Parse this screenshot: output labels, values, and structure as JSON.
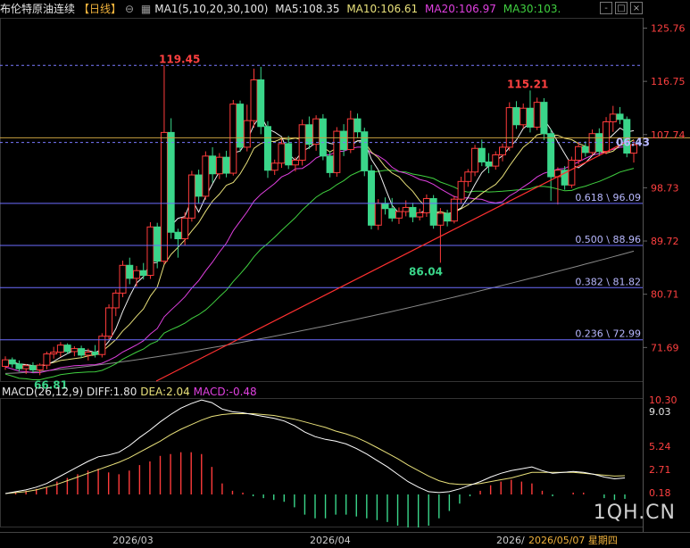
{
  "header": {
    "title": "布伦特原油连续",
    "period": "【日线】",
    "ctrl_icon": "circle-minus-icon",
    "ma_icon": "square-grid-icon",
    "ma1": "MA1(5,10,20,30,100)",
    "ma5": "MA5:108.35",
    "ma10": "MA10:106.61",
    "ma20": "MA20:106.97",
    "ma30": "MA30:103."
  },
  "window_buttons": [
    "-",
    "□",
    "×"
  ],
  "macd_header": {
    "title": "MACD(26,12,9) DIFF:1.80",
    "dea": "DEA:2.04",
    "macd": "MACD:-0.48"
  },
  "watermark": "1QH.CN",
  "colors": {
    "up": "#ff3b3b",
    "down": "#3ad68a",
    "ma5": "#f0f0f0",
    "ma10": "#e8e07a",
    "ma20": "#e040e0",
    "ma30": "#40d040",
    "ma100": "#8a8a8a",
    "trendline": "#ff3030",
    "fib": "#6c6cff"
  },
  "chart_data": [
    {
      "type": "candlestick",
      "ylim": [
        66.0,
        127.5
      ],
      "y_ticks": [
        125.76,
        116.75,
        107.74,
        98.73,
        89.72,
        80.71,
        71.69
      ],
      "x_labels": [
        "2026/03",
        "2026/04",
        "2026/"
      ],
      "date_label": "2026/05/07 星期四",
      "annotations": [
        {
          "text": "119.45",
          "value": 119.45
        },
        {
          "text": "115.21",
          "value": 115.21
        },
        {
          "text": "86.04",
          "value": 86.04
        },
        {
          "text": "66.81",
          "value": 66.81
        },
        {
          "text": "06.43",
          "value": 106.43
        }
      ],
      "fib_levels": [
        {
          "label": "0.618 \\ 96.09",
          "value": 96.09
        },
        {
          "label": "0.500 \\ 88.96",
          "value": 88.96
        },
        {
          "label": "0.382 \\ 81.82",
          "value": 81.82
        },
        {
          "label": "0.236 \\ 72.99",
          "value": 72.99
        }
      ],
      "reference_lines": [
        119.45,
        106.4
      ],
      "current_price": 107.2,
      "candles": [
        [
          68.5,
          70.2,
          67.9,
          69.6
        ],
        [
          69.6,
          70.0,
          68.3,
          68.9
        ],
        [
          68.9,
          69.5,
          67.6,
          68.1
        ],
        [
          68.1,
          68.9,
          67.2,
          68.6
        ],
        [
          68.6,
          69.2,
          67.4,
          67.9
        ],
        [
          67.9,
          69.0,
          67.0,
          68.7
        ],
        [
          68.7,
          71.0,
          68.0,
          70.6
        ],
        [
          70.6,
          71.8,
          69.8,
          70.9
        ],
        [
          70.9,
          72.6,
          70.1,
          72.1
        ],
        [
          72.1,
          72.4,
          70.6,
          71.0
        ],
        [
          71.0,
          71.9,
          70.2,
          71.5
        ],
        [
          71.5,
          72.0,
          69.9,
          70.4
        ],
        [
          70.4,
          71.5,
          69.5,
          70.9
        ],
        [
          70.9,
          72.1,
          70.0,
          70.5
        ],
        [
          70.5,
          74.1,
          70.0,
          73.6
        ],
        [
          73.6,
          79.0,
          73.0,
          78.4
        ],
        [
          78.4,
          81.5,
          77.0,
          80.9
        ],
        [
          80.9,
          86.4,
          80.2,
          85.6
        ],
        [
          85.6,
          86.9,
          82.4,
          83.4
        ],
        [
          83.4,
          85.5,
          82.0,
          84.7
        ],
        [
          84.7,
          86.0,
          83.2,
          83.9
        ],
        [
          83.9,
          92.9,
          83.3,
          92.1
        ],
        [
          92.1,
          92.8,
          85.1,
          86.3
        ],
        [
          86.3,
          119.45,
          85.8,
          108.1
        ],
        [
          108.1,
          110.5,
          90.1,
          91.2
        ],
        [
          91.2,
          91.8,
          86.9,
          90.1
        ],
        [
          90.1,
          94.6,
          89.0,
          93.6
        ],
        [
          93.6,
          101.6,
          93.0,
          100.9
        ],
        [
          100.9,
          101.8,
          96.0,
          97.3
        ],
        [
          97.3,
          104.9,
          96.7,
          104.1
        ],
        [
          104.1,
          105.6,
          99.6,
          101.1
        ],
        [
          101.1,
          104.6,
          100.2,
          103.9
        ],
        [
          103.9,
          105.0,
          100.5,
          101.2
        ],
        [
          101.2,
          113.6,
          100.8,
          112.9
        ],
        [
          112.9,
          113.5,
          104.8,
          105.6
        ],
        [
          105.6,
          112.8,
          104.9,
          110.1
        ],
        [
          110.1,
          118.9,
          108.9,
          117.0
        ],
        [
          117.0,
          119.2,
          107.8,
          109.1
        ],
        [
          109.1,
          110.0,
          100.4,
          101.7
        ],
        [
          101.7,
          103.5,
          100.9,
          102.9
        ],
        [
          102.9,
          107.0,
          102.1,
          106.2
        ],
        [
          106.2,
          107.5,
          101.9,
          102.6
        ],
        [
          102.6,
          103.9,
          101.5,
          103.4
        ],
        [
          103.4,
          110.3,
          102.5,
          109.4
        ],
        [
          109.4,
          110.8,
          105.3,
          106.1
        ],
        [
          106.1,
          111.0,
          105.0,
          110.4
        ],
        [
          110.4,
          111.2,
          103.4,
          104.1
        ],
        [
          104.1,
          104.9,
          100.5,
          101.3
        ],
        [
          101.3,
          109.0,
          100.6,
          108.3
        ],
        [
          108.3,
          109.5,
          104.1,
          105.2
        ],
        [
          105.2,
          111.8,
          104.6,
          110.4
        ],
        [
          110.4,
          111.3,
          107.2,
          108.2
        ],
        [
          108.2,
          108.9,
          100.7,
          101.6
        ],
        [
          101.6,
          102.6,
          91.7,
          92.4
        ],
        [
          92.4,
          96.8,
          91.6,
          96.1
        ],
        [
          96.1,
          97.1,
          94.2,
          95.2
        ],
        [
          95.2,
          97.0,
          93.0,
          93.6
        ],
        [
          93.6,
          95.4,
          92.6,
          94.7
        ],
        [
          94.7,
          96.6,
          93.9,
          95.4
        ],
        [
          95.4,
          96.2,
          92.9,
          93.8
        ],
        [
          93.8,
          95.2,
          93.2,
          94.5
        ],
        [
          94.5,
          97.6,
          93.8,
          96.9
        ],
        [
          96.9,
          97.5,
          91.8,
          92.4
        ],
        [
          92.4,
          95.3,
          86.04,
          94.4
        ],
        [
          94.4,
          95.0,
          92.2,
          93.1
        ],
        [
          93.1,
          97.4,
          92.7,
          96.8
        ],
        [
          96.8,
          100.6,
          96.0,
          99.8
        ],
        [
          99.8,
          101.9,
          98.9,
          101.4
        ],
        [
          101.4,
          106.0,
          100.7,
          105.4
        ],
        [
          105.4,
          106.9,
          102.4,
          103.1
        ],
        [
          103.1,
          104.6,
          101.2,
          102.4
        ],
        [
          102.4,
          104.9,
          101.8,
          104.3
        ],
        [
          104.3,
          106.2,
          103.2,
          105.6
        ],
        [
          105.6,
          113.2,
          105.0,
          112.3
        ],
        [
          112.3,
          113.4,
          108.7,
          109.4
        ],
        [
          109.4,
          113.0,
          108.8,
          112.2
        ],
        [
          112.2,
          115.21,
          108.1,
          109.0
        ],
        [
          109.0,
          114.0,
          108.5,
          113.2
        ],
        [
          113.2,
          113.9,
          106.8,
          107.9
        ],
        [
          107.9,
          108.7,
          96.5,
          100.6
        ],
        [
          100.6,
          102.2,
          95.9,
          101.7
        ],
        [
          101.7,
          102.4,
          98.4,
          99.2
        ],
        [
          99.2,
          104.0,
          98.7,
          103.4
        ],
        [
          103.4,
          106.5,
          102.7,
          105.7
        ],
        [
          105.7,
          106.6,
          104.0,
          104.7
        ],
        [
          104.7,
          108.6,
          104.2,
          107.9
        ],
        [
          107.9,
          108.8,
          104.1,
          104.9
        ],
        [
          104.9,
          110.7,
          104.4,
          109.9
        ],
        [
          109.9,
          112.6,
          108.2,
          111.2
        ],
        [
          111.2,
          112.4,
          109.5,
          110.3
        ],
        [
          110.3,
          110.8,
          103.9,
          104.6
        ],
        [
          104.6,
          106.8,
          103.0,
          106.0
        ]
      ],
      "ma100": {
        "start": 67.3,
        "end": 88.0
      }
    },
    {
      "type": "macd",
      "ylim": [
        -3.5,
        10.5
      ],
      "y_ticks": [
        10.3,
        9.03,
        5.24,
        2.71,
        0.18
      ],
      "diff": [
        0.1,
        0.3,
        0.5,
        0.8,
        1.2,
        1.8,
        2.4,
        3.0,
        3.6,
        4.1,
        4.3,
        4.6,
        5.3,
        6.2,
        7.0,
        7.9,
        8.7,
        9.4,
        9.9,
        10.3,
        10.0,
        9.3,
        9.0,
        8.9,
        8.7,
        8.5,
        8.3,
        8.0,
        7.5,
        6.8,
        6.3,
        6.0,
        5.8,
        5.5,
        5.0,
        4.4,
        3.7,
        3.0,
        2.2,
        1.4,
        0.8,
        0.3,
        0.2,
        0.3,
        0.6,
        1.0,
        1.4,
        1.9,
        2.3,
        2.6,
        2.8,
        3.0,
        2.6,
        2.3,
        2.4,
        2.5,
        2.4,
        2.2,
        1.9,
        1.7,
        1.8
      ],
      "dea": [
        0.1,
        0.2,
        0.3,
        0.5,
        0.8,
        1.1,
        1.5,
        1.9,
        2.3,
        2.7,
        3.1,
        3.5,
        4.0,
        4.6,
        5.2,
        5.8,
        6.5,
        7.1,
        7.6,
        8.1,
        8.5,
        8.7,
        8.8,
        8.8,
        8.8,
        8.7,
        8.6,
        8.4,
        8.2,
        7.9,
        7.6,
        7.3,
        6.9,
        6.6,
        6.2,
        5.7,
        5.1,
        4.5,
        3.9,
        3.2,
        2.6,
        2.0,
        1.5,
        1.2,
        1.1,
        1.1,
        1.2,
        1.4,
        1.6,
        1.8,
        2.1,
        2.4,
        2.4,
        2.4,
        2.4,
        2.4,
        2.3,
        2.2,
        2.1,
        2.0,
        2.04
      ],
      "hist": [
        0.0,
        0.2,
        0.4,
        0.6,
        0.8,
        1.4,
        1.8,
        2.2,
        2.6,
        2.8,
        2.4,
        2.2,
        2.6,
        3.2,
        3.6,
        4.2,
        4.4,
        4.6,
        4.6,
        4.4,
        3.0,
        1.2,
        0.4,
        0.2,
        -0.2,
        -0.4,
        -0.6,
        -0.8,
        -1.4,
        -2.2,
        -2.6,
        -2.6,
        -2.2,
        -2.2,
        -2.4,
        -2.6,
        -2.8,
        -3.0,
        -3.4,
        -3.6,
        -3.6,
        -3.4,
        -2.6,
        -1.8,
        -1.0,
        -0.2,
        0.4,
        1.0,
        1.4,
        1.6,
        1.4,
        1.2,
        0.4,
        -0.2,
        0.0,
        0.2,
        0.2,
        0.0,
        -0.4,
        -0.6,
        -0.48
      ]
    }
  ]
}
